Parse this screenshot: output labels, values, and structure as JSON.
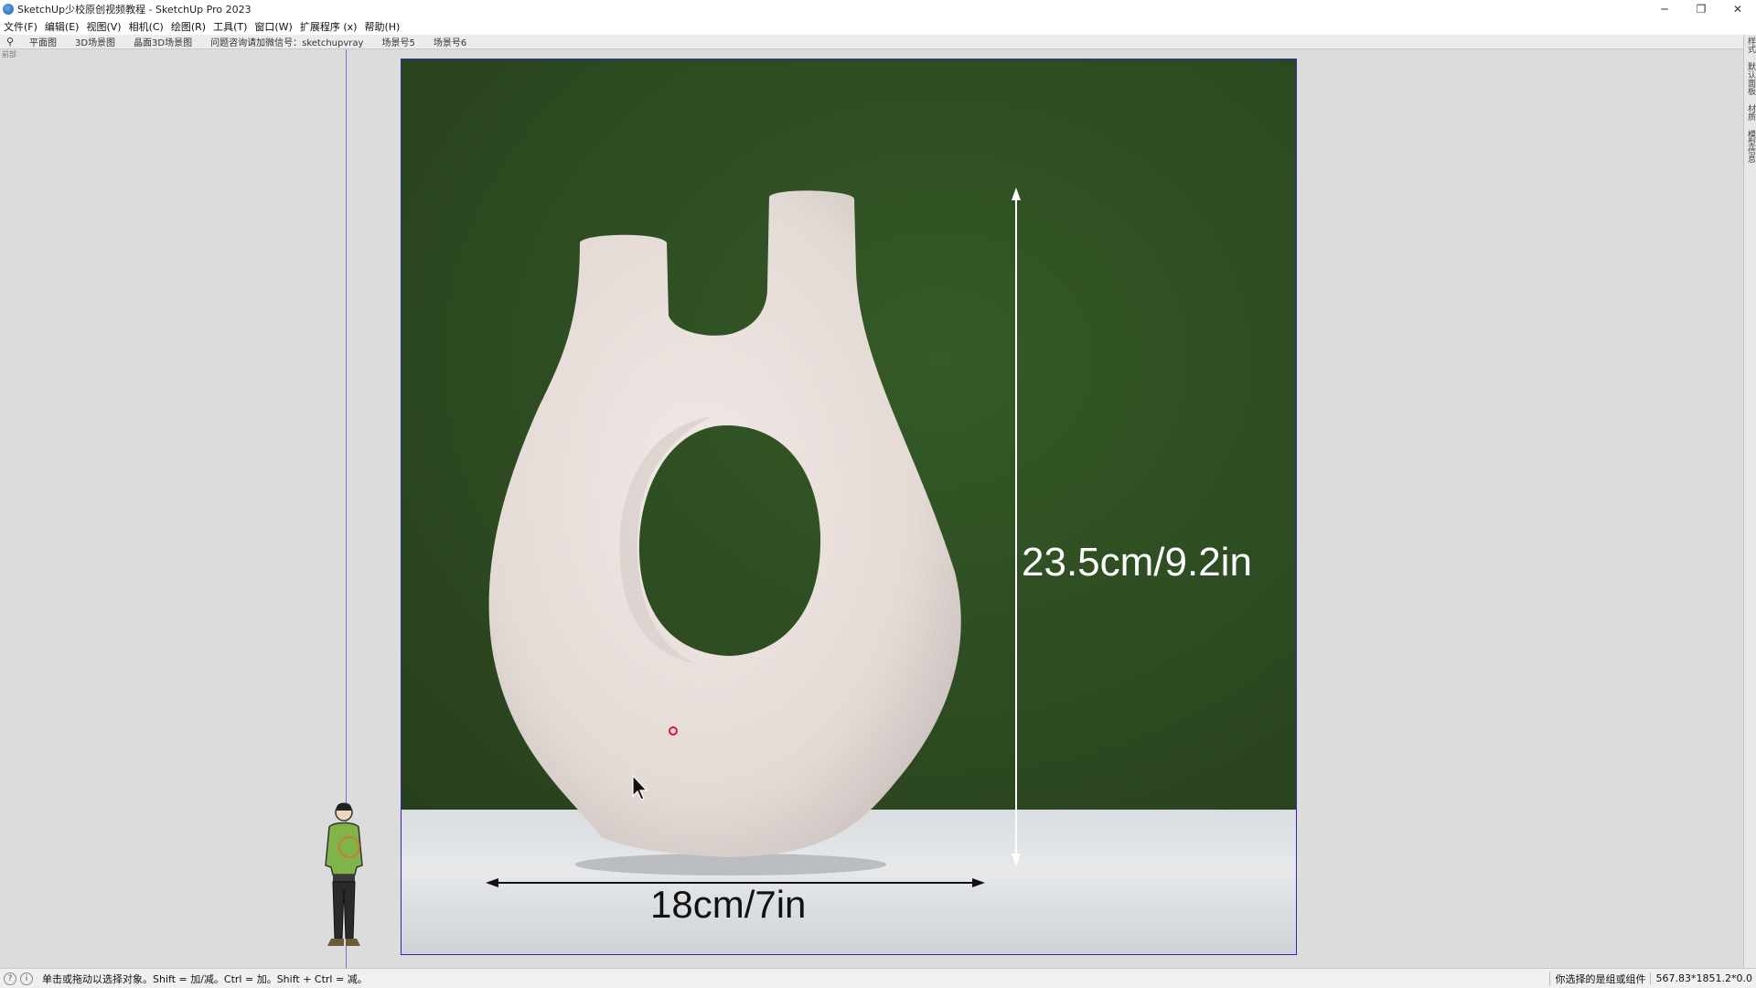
{
  "window": {
    "title": "SketchUp少校原创视频教程 - SketchUp Pro 2023",
    "controls": [
      "─",
      "❐",
      "✕"
    ]
  },
  "menu": [
    "文件(F)",
    "编辑(E)",
    "视图(V)",
    "相机(C)",
    "绘图(R)",
    "工具(T)",
    "窗口(W)",
    "扩展程序 (x)",
    "帮助(H)"
  ],
  "scene_tabs": [
    "平面图",
    "3D场景图",
    "晶面3D场景图",
    "问题咨询请加微信号：sketchupvray",
    "场景号5",
    "场景号6"
  ],
  "view_label": "前部",
  "image": {
    "height_dimension": "23.5cm/9.2in",
    "width_dimension": "18cm/7in"
  },
  "right_tray_tabs": [
    "样式",
    "默认面板",
    "材质",
    "模型信息"
  ],
  "status": {
    "hint": "单击或拖动以选择对象。Shift = 加/减。Ctrl = 加。Shift + Ctrl = 减。",
    "selection": "你选择的是组或组件",
    "measurements": "567.83*1851.2*0.0"
  },
  "colors": {
    "wall_green": "#2f4d22",
    "selection_border": "#2e2ab0",
    "axis_blue": "#6f74c9"
  }
}
